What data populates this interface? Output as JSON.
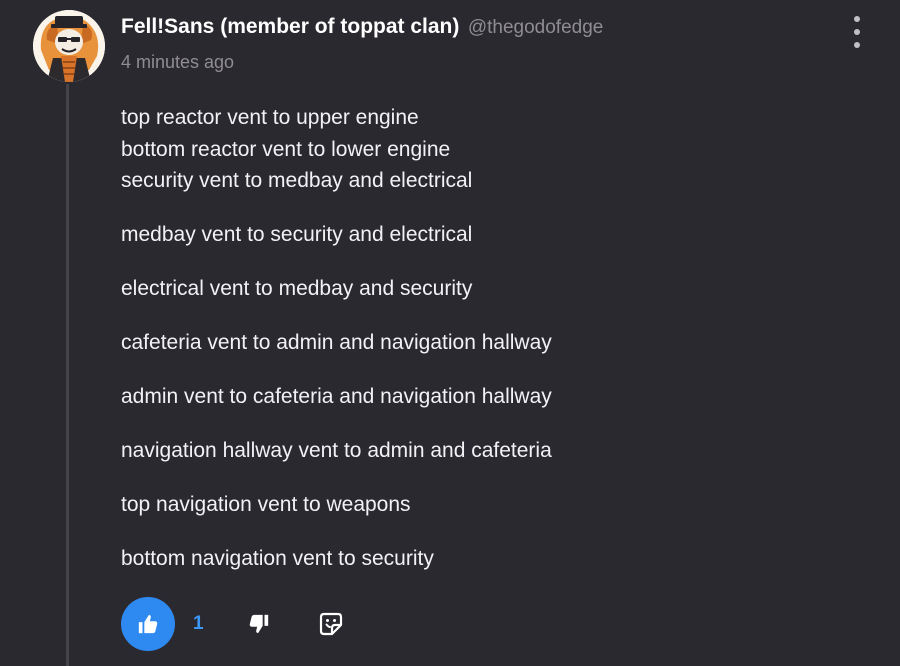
{
  "comment": {
    "username": "Fell!Sans (member of toppat clan)",
    "handle": "@thegodofedge",
    "timestamp": "4 minutes ago",
    "paragraphs": [
      {
        "lines": [
          "top reactor vent to upper engine",
          "bottom reactor vent to lower engine",
          "security vent to medbay and electrical"
        ]
      },
      {
        "lines": [
          "medbay vent to security and electrical"
        ]
      },
      {
        "lines": [
          "electrical vent to medbay and security"
        ]
      },
      {
        "lines": [
          "cafeteria vent to admin and navigation hallway"
        ]
      },
      {
        "lines": [
          "admin vent to cafeteria and navigation hallway"
        ]
      },
      {
        "lines": [
          "navigation hallway vent to admin and cafeteria"
        ]
      },
      {
        "lines": [
          "top navigation vent to weapons"
        ]
      },
      {
        "lines": [
          "bottom navigation vent to security"
        ]
      }
    ],
    "likes": "1"
  },
  "icons": {
    "menu": "more-vertical-icon",
    "like": "thumbs-up-icon",
    "dislike": "thumbs-down-icon",
    "reaction": "sticker-smile-icon"
  },
  "colors": {
    "background": "#2b2930",
    "accent": "#2e8af0",
    "muted": "#8f8c93",
    "text": "#f2f1f4"
  }
}
